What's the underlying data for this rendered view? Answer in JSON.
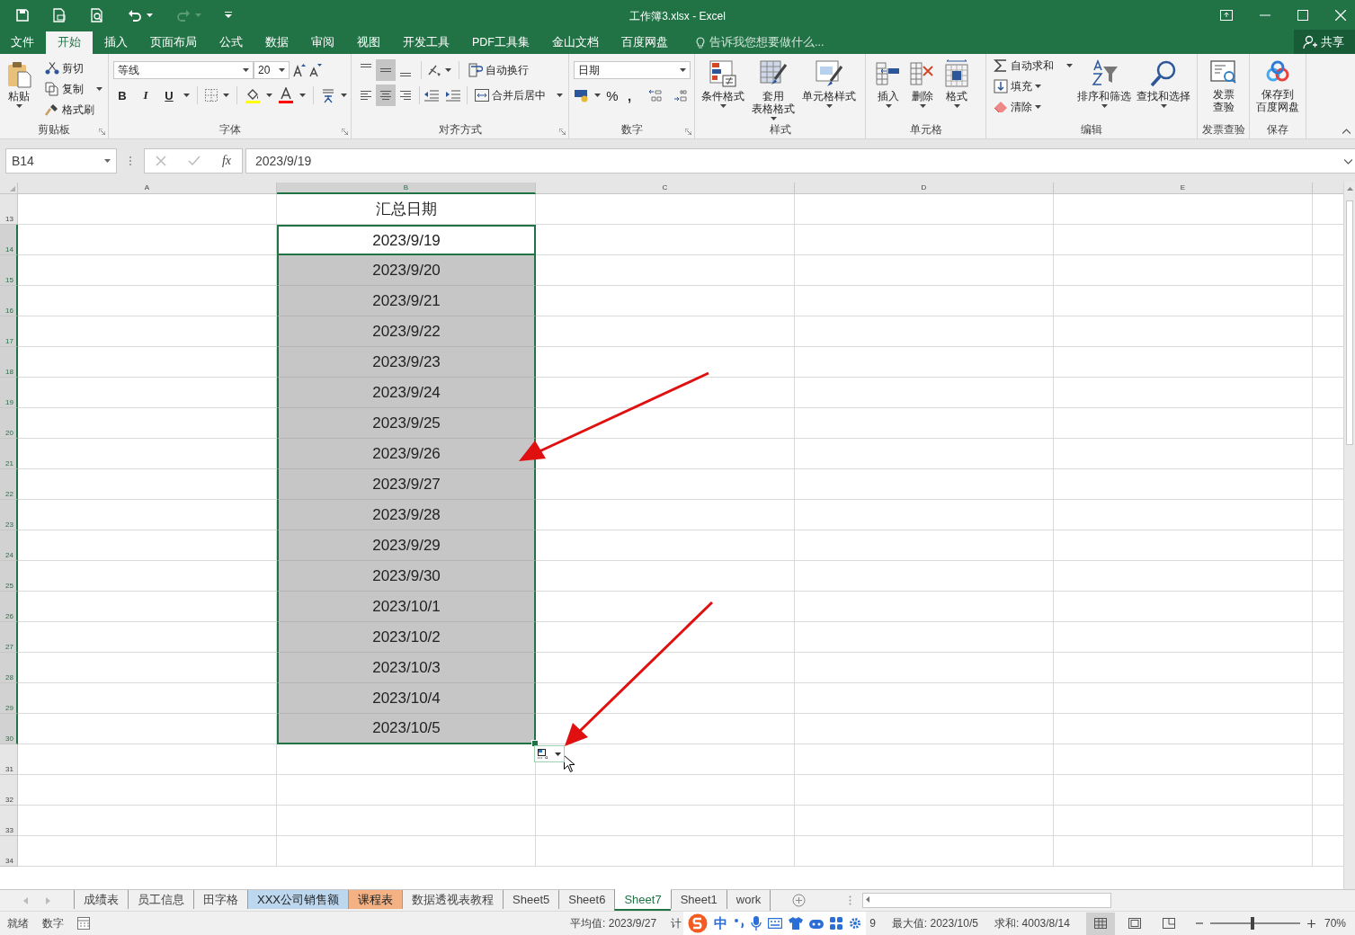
{
  "window": {
    "title": "工作簿3.xlsx - Excel"
  },
  "menu_tabs": [
    {
      "label": "文件",
      "selected": false
    },
    {
      "label": "开始",
      "selected": true
    },
    {
      "label": "插入",
      "selected": false
    },
    {
      "label": "页面布局",
      "selected": false
    },
    {
      "label": "公式",
      "selected": false
    },
    {
      "label": "数据",
      "selected": false
    },
    {
      "label": "审阅",
      "selected": false
    },
    {
      "label": "视图",
      "selected": false
    },
    {
      "label": "开发工具",
      "selected": false
    },
    {
      "label": "PDF工具集",
      "selected": false
    },
    {
      "label": "金山文档",
      "selected": false
    },
    {
      "label": "百度网盘",
      "selected": false
    }
  ],
  "tell_me": {
    "placeholder": "告诉我您想要做什么..."
  },
  "share": "共享",
  "ribbon": {
    "clipboard": {
      "label": "剪贴板",
      "paste": "粘贴",
      "items": [
        "剪切",
        "复制",
        "格式刷"
      ]
    },
    "font": {
      "label": "字体",
      "font_name": "等线",
      "font_size": "20",
      "styles": [
        "B",
        "I",
        "U"
      ]
    },
    "alignment": {
      "label": "对齐方式",
      "wrap": "自动换行",
      "merge": "合并后居中",
      "vertical": [
        {
          "pressed": false
        },
        {
          "pressed": true
        },
        {
          "pressed": false
        }
      ],
      "horizontal": [
        {
          "pressed": false
        },
        {
          "pressed": true
        },
        {
          "pressed": false
        }
      ]
    },
    "number": {
      "label": "数字",
      "format": "日期",
      "percent": "%",
      "comma": ","
    },
    "styles": {
      "label": "样式",
      "buttons": [
        [
          "条件格式"
        ],
        [
          "套用",
          "表格格式"
        ],
        [
          "单元格样式"
        ]
      ]
    },
    "cells": {
      "label": "单元格",
      "buttons": [
        "插入",
        "删除",
        "格式"
      ]
    },
    "editing": {
      "label": "编辑",
      "items": [
        "自动求和",
        "填充",
        "清除"
      ],
      "buttons": [
        "排序和筛选",
        "查找和选择"
      ]
    },
    "invoice": {
      "label": "发票查验",
      "button": [
        "发票",
        "查验"
      ]
    },
    "save": {
      "label": "保存",
      "button": [
        "保存到",
        "百度网盘"
      ]
    }
  },
  "formula_bar": {
    "name_box": "B14",
    "function_button": "fx",
    "formula": "2023/9/19"
  },
  "columns": [
    {
      "label": "A",
      "selected": false
    },
    {
      "label": "B",
      "selected": true
    },
    {
      "label": "C",
      "selected": false
    },
    {
      "label": "D",
      "selected": false
    },
    {
      "label": "E",
      "selected": false
    }
  ],
  "rows": [
    {
      "number": "13",
      "value": "汇总日期",
      "selected": false,
      "active": false
    },
    {
      "number": "14",
      "value": "2023/9/19",
      "selected": true,
      "active": true
    },
    {
      "number": "15",
      "value": "2023/9/20",
      "selected": true,
      "active": false
    },
    {
      "number": "16",
      "value": "2023/9/21",
      "selected": true,
      "active": false
    },
    {
      "number": "17",
      "value": "2023/9/22",
      "selected": true,
      "active": false
    },
    {
      "number": "18",
      "value": "2023/9/23",
      "selected": true,
      "active": false
    },
    {
      "number": "19",
      "value": "2023/9/24",
      "selected": true,
      "active": false
    },
    {
      "number": "20",
      "value": "2023/9/25",
      "selected": true,
      "active": false
    },
    {
      "number": "21",
      "value": "2023/9/26",
      "selected": true,
      "active": false
    },
    {
      "number": "22",
      "value": "2023/9/27",
      "selected": true,
      "active": false
    },
    {
      "number": "23",
      "value": "2023/9/28",
      "selected": true,
      "active": false
    },
    {
      "number": "24",
      "value": "2023/9/29",
      "selected": true,
      "active": false
    },
    {
      "number": "25",
      "value": "2023/9/30",
      "selected": true,
      "active": false
    },
    {
      "number": "26",
      "value": "2023/10/1",
      "selected": true,
      "active": false
    },
    {
      "number": "27",
      "value": "2023/10/2",
      "selected": true,
      "active": false
    },
    {
      "number": "28",
      "value": "2023/10/3",
      "selected": true,
      "active": false
    },
    {
      "number": "29",
      "value": "2023/10/4",
      "selected": true,
      "active": false
    },
    {
      "number": "30",
      "value": "2023/10/5",
      "selected": true,
      "active": false
    },
    {
      "number": "31",
      "selected": false,
      "active": false
    },
    {
      "number": "32",
      "selected": false,
      "active": false
    },
    {
      "number": "33",
      "selected": false,
      "active": false
    },
    {
      "number": "34",
      "selected": false,
      "active": false
    }
  ],
  "sheet_tabs": [
    {
      "label": "成绩表",
      "selected": false
    },
    {
      "label": "员工信息",
      "selected": false
    },
    {
      "label": "田字格",
      "selected": false
    },
    {
      "label": "XXX公司销售额",
      "selected": false,
      "color": "#bdd7ee"
    },
    {
      "label": "课程表",
      "selected": false,
      "color": "#f4b183"
    },
    {
      "label": "数据透视表教程",
      "selected": false
    },
    {
      "label": "Sheet5",
      "selected": false
    },
    {
      "label": "Sheet6",
      "selected": false
    },
    {
      "label": "Sheet7",
      "selected": true
    },
    {
      "label": "Sheet1",
      "selected": false
    },
    {
      "label": "work",
      "selected": false
    }
  ],
  "status_bar": {
    "left": [
      "就绪",
      "数字"
    ],
    "stats_before": [
      "平均值: 2023/9/27",
      "计"
    ],
    "ime": "中",
    "stats_after": [
      "9",
      "最大值: 2023/10/5",
      "求和: 4003/8/14"
    ],
    "views": [
      {
        "selected": true
      },
      {
        "selected": false
      },
      {
        "selected": false
      }
    ],
    "zoom": {
      "level": 0.47,
      "reading": "70%"
    }
  }
}
